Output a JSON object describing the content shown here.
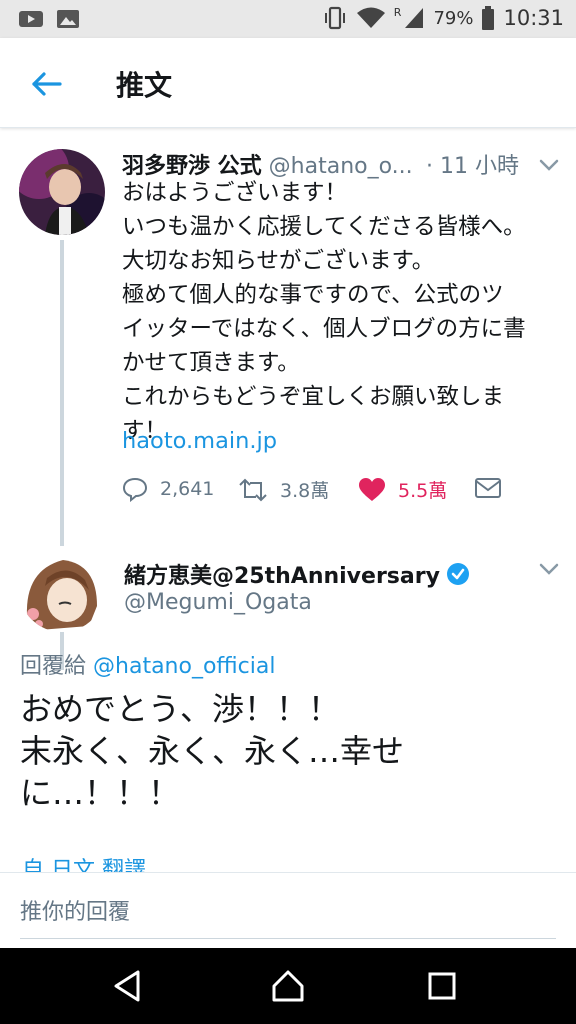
{
  "status_bar": {
    "battery": "79%",
    "time": "10:31",
    "signal_label": "R"
  },
  "header": {
    "title": "推文"
  },
  "tweet": {
    "name": "羽多野渉 公式",
    "handle": "@hatano_o...",
    "time": "· 11 小時",
    "lines": [
      "おはようございます！",
      "いつも温かく応援してくださる皆様へ。",
      "大切なお知らせがございます。",
      "極めて個人的な事ですので、公式のツ",
      "イッターではなく、個人ブログの方に書",
      "かせて頂きます。",
      "これからもどうぞ宜しくお願い致しま",
      "す！"
    ],
    "link": "haoto.main.jp",
    "replies": "2,641",
    "retweets": "3.8萬",
    "likes": "5.5萬"
  },
  "reply": {
    "name": "緒方恵美@25thAnniversary",
    "handle": "@Megumi_Ogata",
    "reply_to_label": "回覆給",
    "reply_to_handle": "@hatano_official",
    "lines": [
      "おめでとう、渉！！！",
      "末永く、永く、永く…幸せ",
      "に…！！！"
    ],
    "translate": "自 日文 翻譯"
  },
  "compose": {
    "placeholder": "推你的回覆"
  },
  "colors": {
    "accent": "#1b95e0",
    "like": "#e0245e",
    "secondary_text": "#657786"
  }
}
